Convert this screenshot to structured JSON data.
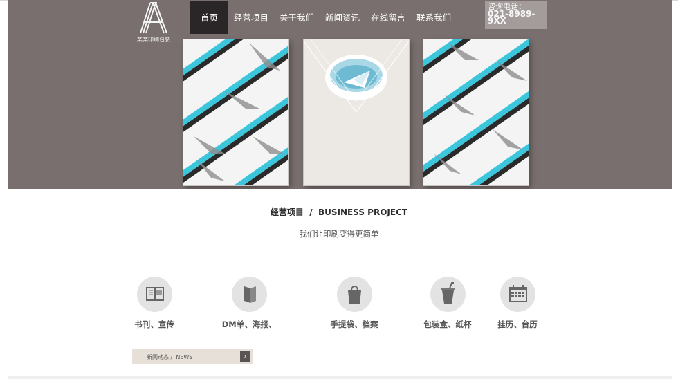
{
  "logo": {
    "text": "某某印刷包装",
    "icon": "logo-a-mark"
  },
  "nav": {
    "items": [
      {
        "label": "首页",
        "active": true
      },
      {
        "label": "经营项目",
        "active": false
      },
      {
        "label": "关于我们",
        "active": false
      },
      {
        "label": "新闻资讯",
        "active": false
      },
      {
        "label": "在线留言",
        "active": false
      },
      {
        "label": "联系我们",
        "active": false
      }
    ]
  },
  "hotline": {
    "label": "咨询电话：",
    "number": "021-8989-9XX"
  },
  "section": {
    "title": "经营项目  /  BUSINESS PROJECT",
    "subtitle": "我们让印刷变得更简单"
  },
  "services": [
    {
      "label": "书刊、宣传",
      "icon": "book-icon"
    },
    {
      "label": "DM单、海报、",
      "icon": "leaflet-icon"
    },
    {
      "label": "手提袋、档案",
      "icon": "bag-icon"
    },
    {
      "label": "包装盒、纸杯",
      "icon": "cup-icon"
    },
    {
      "label": "挂历、台历",
      "icon": "calendar-icon"
    }
  ],
  "news": {
    "label": "新闻动态 /  NEWS",
    "more": "›"
  },
  "colors": {
    "hero_bg": "#786f6e",
    "nav_active": "#2a2627",
    "accent_cyan": "#3cc6dc"
  }
}
